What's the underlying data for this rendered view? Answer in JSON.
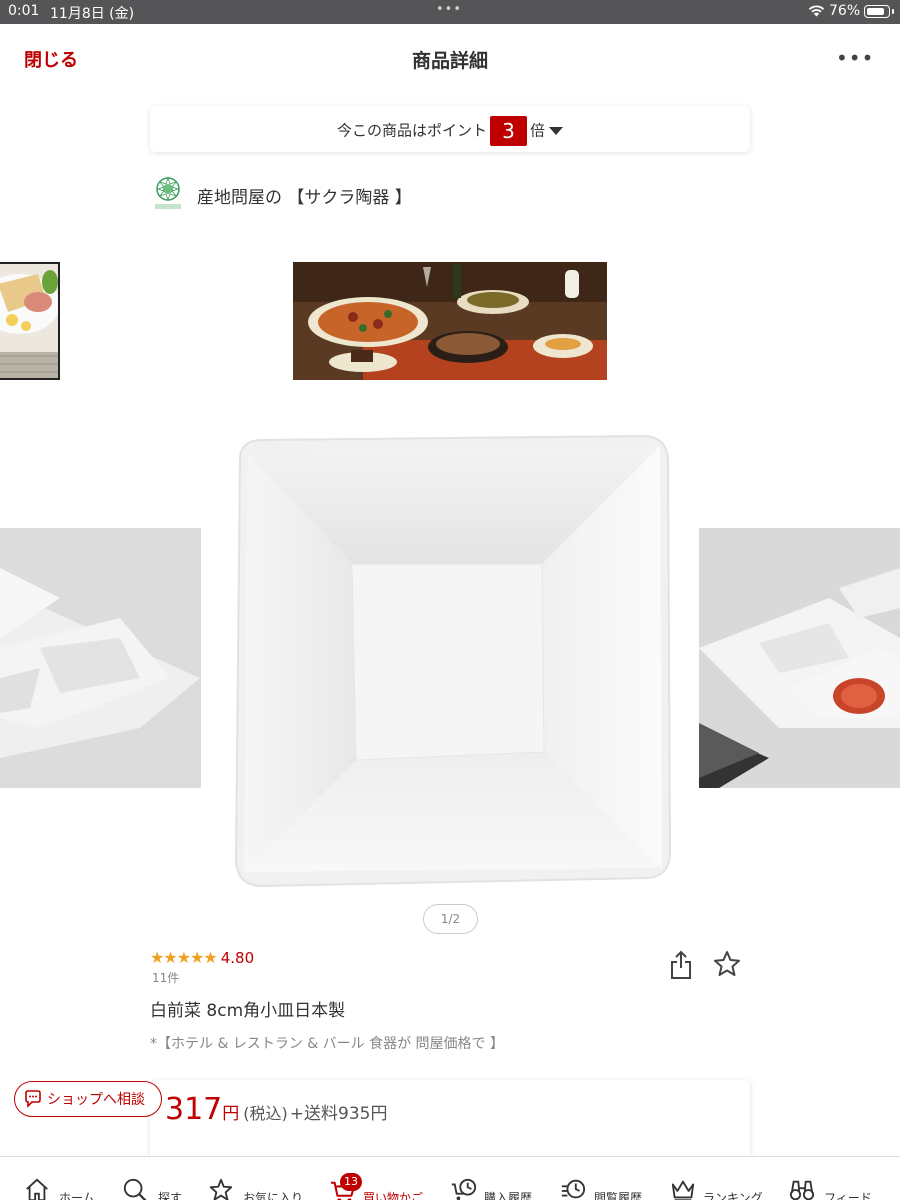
{
  "status_bar": {
    "time": "0:01",
    "date": "11月8日 (金)",
    "dots": "•••",
    "battery": "76%"
  },
  "header": {
    "close": "閉じる",
    "title": "商品詳細",
    "more": "•••"
  },
  "point": {
    "prefix": "今この商品はポイント",
    "multiplier": "3",
    "suffix": "倍"
  },
  "shop": {
    "name": "産地問屋の 【サクラ陶器 】",
    "logo_text": "サクラ陶器"
  },
  "gallery": {
    "pager": "1/2"
  },
  "product": {
    "rating_stars": "★★★★★",
    "rating_value": "4.80",
    "review_count": "11件",
    "name": "白前菜 8cm角小皿日本製",
    "catchcopy": "*【ホテル & レストラン & バール 食器が 問屋価格で 】",
    "price": "317",
    "price_unit": "円",
    "tax_label": "(税込)",
    "shipping": "+送料935円"
  },
  "consult_button": {
    "label": "ショップへ相談"
  },
  "tabbar": {
    "active": "cart",
    "cart_badge": "13",
    "items": [
      {
        "key": "home",
        "label": "ホーム",
        "icon": "home-icon"
      },
      {
        "key": "search",
        "label": "探す",
        "icon": "search-icon"
      },
      {
        "key": "favorites",
        "label": "お気に入り",
        "icon": "star-icon"
      },
      {
        "key": "cart",
        "label": "買い物かご",
        "icon": "cart-icon"
      },
      {
        "key": "purchase_history",
        "label": "購入履歴",
        "icon": "purchase-history-icon"
      },
      {
        "key": "browse_history",
        "label": "閲覧履歴",
        "icon": "browse-history-icon"
      },
      {
        "key": "ranking",
        "label": "ランキング",
        "icon": "crown-icon"
      },
      {
        "key": "feed",
        "label": "フィード",
        "icon": "binoculars-icon"
      }
    ]
  },
  "colors": {
    "accent": "#bf0000",
    "star": "#f0a020",
    "status_bar": "#555557"
  }
}
